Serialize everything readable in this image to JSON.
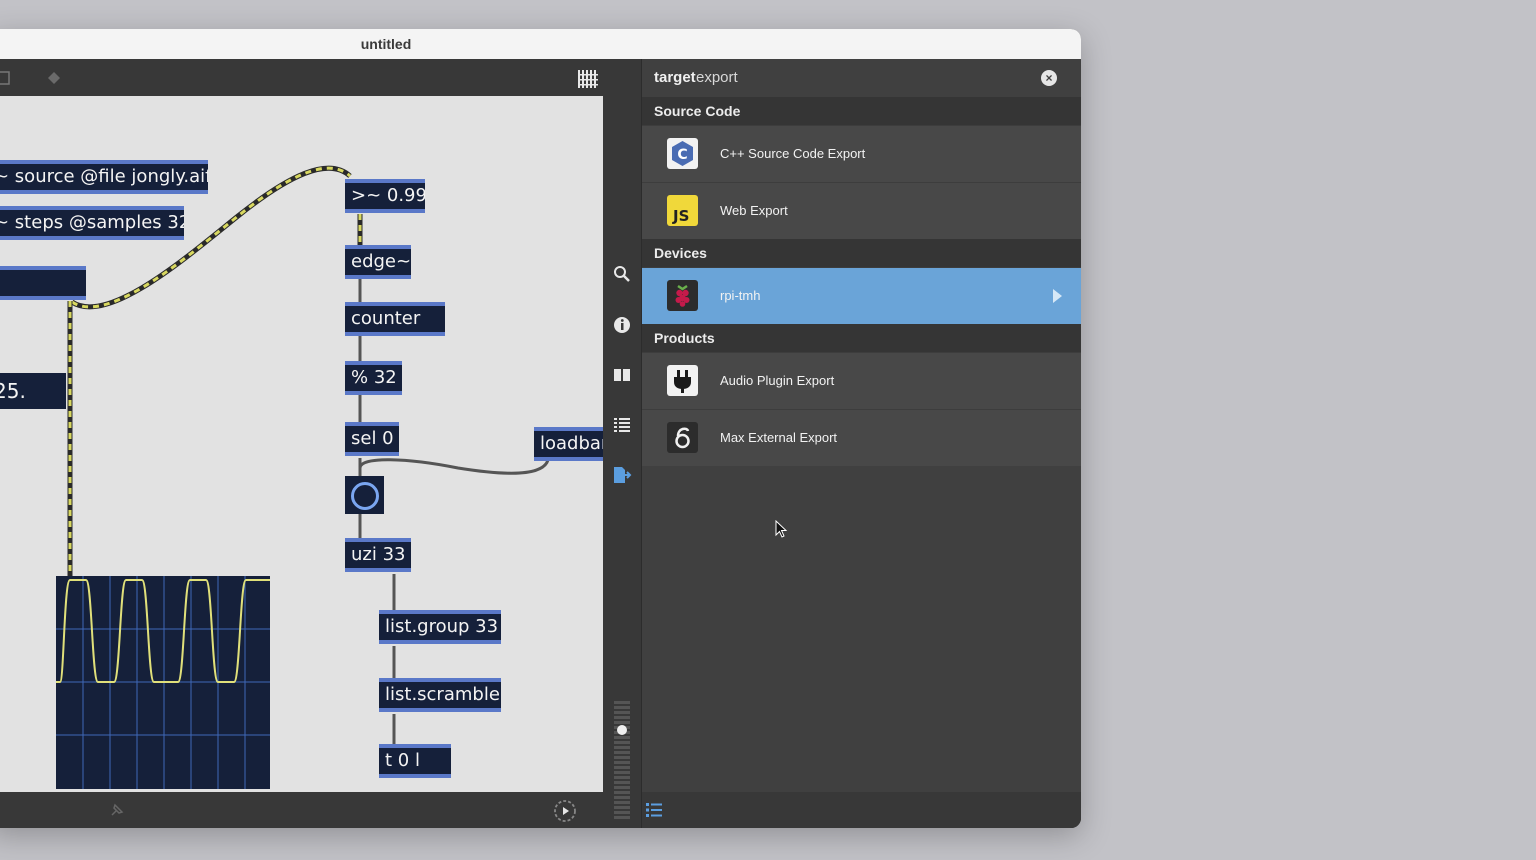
{
  "window": {
    "title": "untitled"
  },
  "patcher": {
    "objects": [
      {
        "id": "source",
        "text": "~ source @file jongly.aif"
      },
      {
        "id": "steps",
        "text": "~ steps @samples 32"
      },
      {
        "id": "number",
        "text": "25."
      },
      {
        "id": "threshold",
        "text": ">~ 0.99"
      },
      {
        "id": "edge",
        "text": "edge~"
      },
      {
        "id": "counter",
        "text": "counter"
      },
      {
        "id": "mod",
        "text": "% 32"
      },
      {
        "id": "sel",
        "text": "sel 0"
      },
      {
        "id": "loadbang",
        "text": "loadbar"
      },
      {
        "id": "uzi",
        "text": "uzi 33"
      },
      {
        "id": "listgroup",
        "text": "list.group 33"
      },
      {
        "id": "listscramble",
        "text": "list.scramble"
      },
      {
        "id": "trigger",
        "text": "t 0 l"
      }
    ]
  },
  "export_panel": {
    "header": {
      "key": "target",
      "value": "export"
    },
    "close_icon": "close-icon",
    "sections": [
      {
        "title": "Source Code",
        "items": [
          {
            "label": "C++ Source Code Export",
            "icon": "cpp-icon"
          },
          {
            "label": "Web Export",
            "icon": "js-icon"
          }
        ]
      },
      {
        "title": "Devices",
        "items": [
          {
            "label": "rpi-tmh",
            "icon": "raspberry-pi-icon",
            "selected": true
          }
        ]
      },
      {
        "title": "Products",
        "items": [
          {
            "label": "Audio Plugin Export",
            "icon": "plug-icon"
          },
          {
            "label": "Max External Export",
            "icon": "max-icon"
          }
        ]
      }
    ],
    "js_badge": "JS",
    "cpp_badge": "C"
  },
  "colors": {
    "selected": "#6aa4d8",
    "object_bg": "#15203a",
    "object_border": "#5a78c8",
    "cable_yellow": "#d8d860",
    "scope_trace": "#e0e07a"
  }
}
